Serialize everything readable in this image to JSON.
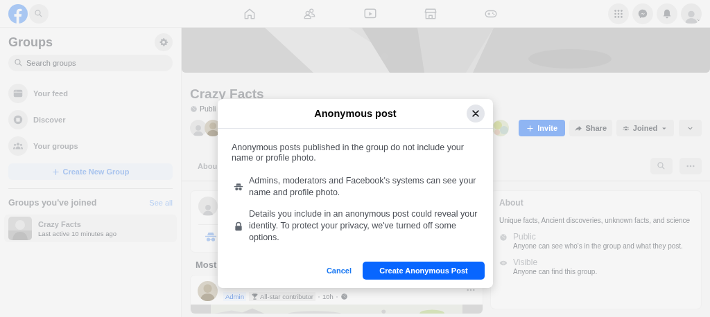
{
  "sidebar": {
    "title": "Groups",
    "search": {
      "placeholder": "Search groups"
    },
    "items": [
      {
        "kind": "feed",
        "label": "Your feed"
      },
      {
        "kind": "discover",
        "label": "Discover"
      },
      {
        "kind": "groups",
        "label": "Your groups"
      }
    ],
    "create_button": "Create New Group",
    "joined_heading": "Groups you've joined",
    "see_all": "See all",
    "joined_groups": [
      {
        "name": "Crazy Facts",
        "activity": "Last active 10 minutes ago"
      }
    ]
  },
  "group": {
    "name": "Crazy Facts",
    "privacy": "Publi",
    "buttons": [
      {
        "kind": "invite",
        "label": "Invite"
      },
      {
        "kind": "share",
        "label": "Share"
      },
      {
        "kind": "joined",
        "label": "Joined"
      }
    ],
    "tab": "Abou"
  },
  "feed_heading": "Most",
  "post": {
    "role": "Admin",
    "badge": "All-star contributor",
    "time": "10h"
  },
  "about": {
    "title": "About",
    "description": "Unique facts, Ancient discoveries, unknown facts, and science",
    "facts": [
      {
        "kind": "public",
        "title": "Public",
        "text": "Anyone can see who's in the group and what they post."
      },
      {
        "kind": "visible",
        "title": "Visible",
        "text": "Anyone can find this group."
      }
    ]
  },
  "dialog": {
    "title": "Anonymous post",
    "intro": "Anonymous posts published in the group do not include your name or profile photo.",
    "points": [
      {
        "kind": "incognito",
        "text": "Admins, moderators and Facebook's systems can see your name and profile photo."
      },
      {
        "kind": "lock",
        "text": "Details you include in an anonymous post could reveal your identity. To protect your privacy, we've turned off some options."
      }
    ],
    "cancel": "Cancel",
    "confirm": "Create Anonymous Post"
  }
}
